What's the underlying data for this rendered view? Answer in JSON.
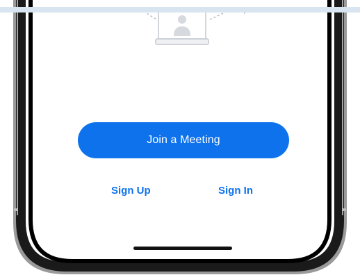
{
  "app": {
    "theme_color": "#0e72ed"
  },
  "illustration": {
    "icon": "user-avatar-card-icon"
  },
  "actions": {
    "join_label": "Join a Meeting",
    "sign_up_label": "Sign Up",
    "sign_in_label": "Sign In"
  },
  "device": {
    "frame_icon": "phone-bezel",
    "home_indicator_icon": "home-indicator-bar"
  }
}
